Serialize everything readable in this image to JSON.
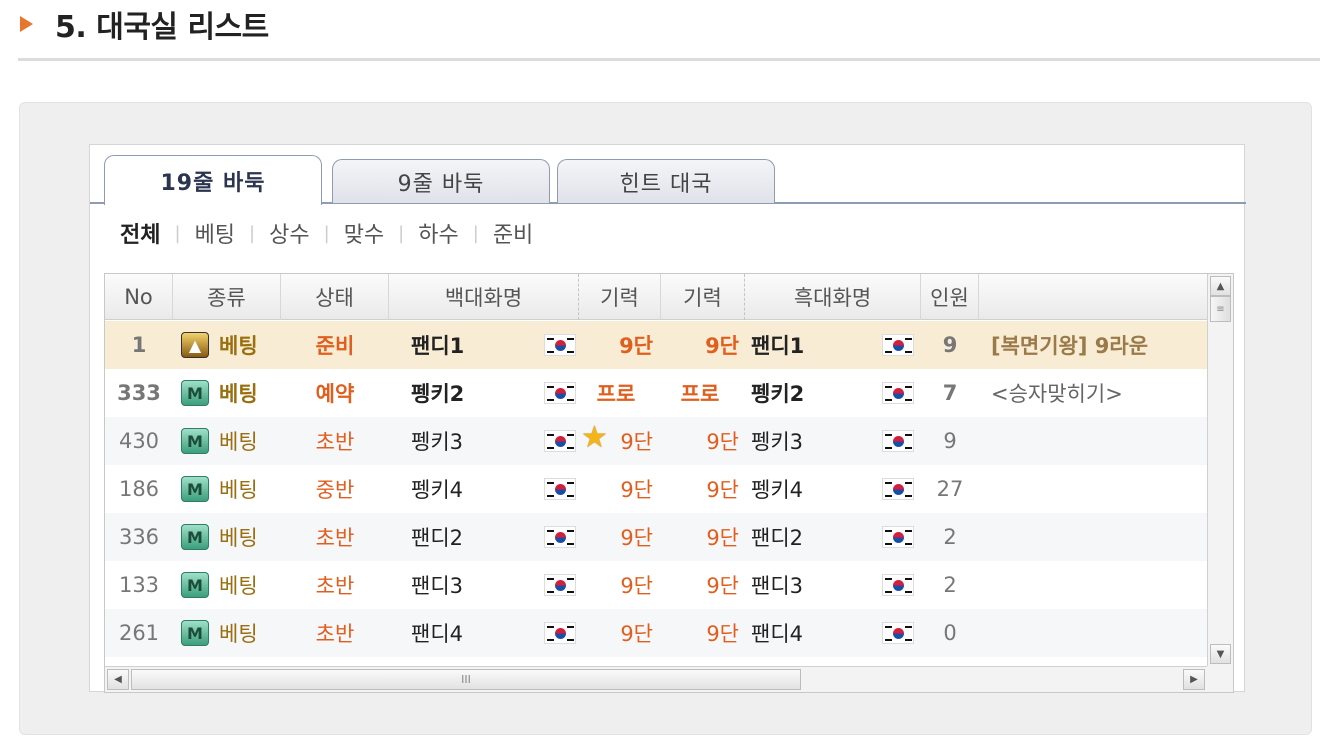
{
  "heading": {
    "title": "5. 대국실 리스트"
  },
  "tabs": [
    {
      "label": "19줄 바둑",
      "active": true
    },
    {
      "label": "9줄 바둑",
      "active": false
    },
    {
      "label": "힌트 대국",
      "active": false
    }
  ],
  "filters": [
    "전체",
    "베팅",
    "상수",
    "맞수",
    "하수",
    "준비"
  ],
  "filters_active": "전체",
  "columns": {
    "no": "No",
    "kind": "종류",
    "status": "상태",
    "white": "백대화명",
    "white_rank": "기력",
    "black_rank": "기력",
    "black": "흑대화명",
    "people": "인원",
    "title": ""
  },
  "rows": [
    {
      "no": "1",
      "kind": "베팅",
      "status": "준비",
      "white": "팬디1",
      "white_rank": "9단",
      "black_rank": "9단",
      "black": "팬디1",
      "people": "9",
      "title": "[복면기왕] 9라운"
    },
    {
      "no": "333",
      "kind": "베팅",
      "status": "예약",
      "white": "펭키2",
      "white_rank": "프로",
      "black_rank": "프로",
      "black": "펭키2",
      "people": "7",
      "title": "<승자맞히기>"
    },
    {
      "no": "430",
      "kind": "베팅",
      "status": "초반",
      "white": "펭키3",
      "white_rank": "9단",
      "black_rank": "9단",
      "black": "펭키3",
      "people": "9",
      "title": ""
    },
    {
      "no": "186",
      "kind": "베팅",
      "status": "중반",
      "white": "펭키4",
      "white_rank": "9단",
      "black_rank": "9단",
      "black": "펭키4",
      "people": "27",
      "title": ""
    },
    {
      "no": "336",
      "kind": "베팅",
      "status": "초반",
      "white": "팬디2",
      "white_rank": "9단",
      "black_rank": "9단",
      "black": "팬디2",
      "people": "2",
      "title": ""
    },
    {
      "no": "133",
      "kind": "베팅",
      "status": "초반",
      "white": "팬디3",
      "white_rank": "9단",
      "black_rank": "9단",
      "black": "팬디3",
      "people": "2",
      "title": ""
    },
    {
      "no": "261",
      "kind": "베팅",
      "status": "초반",
      "white": "팬디4",
      "white_rank": "9단",
      "black_rank": "9단",
      "black": "팬디4",
      "people": "0",
      "title": ""
    }
  ],
  "icons": {
    "kind_icon_text": "M",
    "star": "star-icon",
    "flag": "korea-flag-icon"
  },
  "colors": {
    "accent": "#e8772e",
    "rank": "#e05f1f",
    "kind": "#9a6f10",
    "selected_row": "#f9ecd4"
  },
  "scroll": {
    "h_thumb_glyph": "III"
  }
}
